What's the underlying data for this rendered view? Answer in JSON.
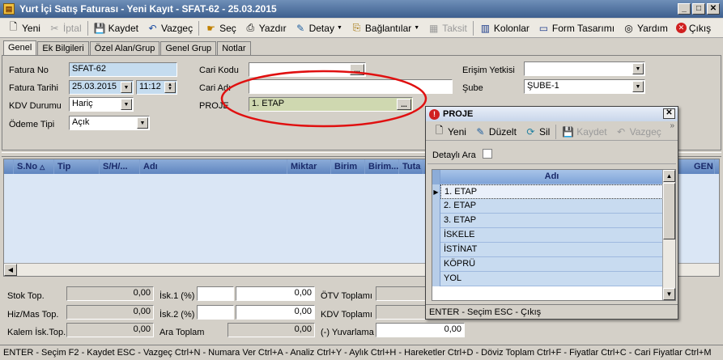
{
  "window": {
    "title": "Yurt İçi Satış Faturası - Yeni Kayıt - SFAT-62 - 25.03.2015"
  },
  "toolbar": {
    "yeni": "Yeni",
    "iptal": "İptal",
    "kaydet": "Kaydet",
    "vazgec": "Vazgeç",
    "sec": "Seç",
    "yazdir": "Yazdır",
    "detay": "Detay",
    "baglantilar": "Bağlantılar",
    "taksit": "Taksit",
    "kolonlar": "Kolonlar",
    "form_tasarim": "Form Tasarımı",
    "yardim": "Yardım",
    "cikis": "Çıkış"
  },
  "tabs": [
    "Genel",
    "Ek Bilgileri",
    "Özel Alan/Grup",
    "Genel Grup",
    "Notlar"
  ],
  "form": {
    "fatura_no_label": "Fatura No",
    "fatura_no": "SFAT-62",
    "fatura_tarihi_label": "Fatura Tarihi",
    "fatura_tarihi": "25.03.2015",
    "saat": "11:12",
    "kdv_durumu_label": "KDV Durumu",
    "kdv_durumu": "Hariç",
    "odeme_tipi_label": "Ödeme Tipi",
    "odeme_tipi": "Açık",
    "cari_kodu_label": "Cari Kodu",
    "cari_kodu": "",
    "cari_adi_label": "Cari Adı",
    "cari_adi": "",
    "proje_label": "PROJE",
    "proje": "1. ETAP",
    "erisim_yetkisi_label": "Erişim Yetkisi",
    "erisim_yetkisi": "",
    "sube_label": "Şube",
    "sube": "ŞUBE-1"
  },
  "grid": {
    "columns": [
      "S.No",
      "Tip",
      "S/H/...",
      "Adı",
      "Miktar",
      "Birim",
      "Birim...",
      "Tuta",
      "GEN"
    ]
  },
  "totals": {
    "stok_top_label": "Stok Top.",
    "stok_top": "0,00",
    "hiz_mas_top_label": "Hiz/Mas Top.",
    "hiz_mas_top": "0,00",
    "kalem_isk_top_label": "Kalem İsk.Top.",
    "kalem_isk_top": "0,00",
    "isk1_label": "İsk.1 (%)",
    "isk1_pct": "",
    "isk1": "0,00",
    "isk2_label": "İsk.2 (%)",
    "isk2_pct": "",
    "isk2": "0,00",
    "ara_toplam_label": "Ara Toplam",
    "ara_toplam": "0,00",
    "otv_toplami_label": "ÖTV Toplamı",
    "kdv_toplami_label": "KDV Toplamı",
    "yuvarlama_label": "(-) Yuvarlama",
    "yuvarlama": "0,00"
  },
  "statusbar": {
    "text": "ENTER - Seçim  F2 - Kaydet  ESC - Vazgeç  Ctrl+N - Numara Ver    Ctrl+A - Analiz  Ctrl+Y - Aylık  Ctrl+H - Hareketler  Ctrl+D - Döviz Toplam  Ctrl+F - Fiyatlar  Ctrl+C - Cari Fiyatlar  Ctrl+M"
  },
  "popup": {
    "title": "PROJE",
    "yeni": "Yeni",
    "duzelt": "Düzelt",
    "sil": "Sil",
    "kaydet": "Kaydet",
    "vazgec": "Vazgeç",
    "detayli_ara": "Detaylı Ara",
    "column": "Adı",
    "items": [
      "1. ETAP",
      "2. ETAP",
      "3. ETAP",
      "İSKELE",
      "İSTİNAT",
      "KÖPRÜ",
      "YOL"
    ],
    "status": "ENTER - Seçim  ESC - Çıkış"
  }
}
